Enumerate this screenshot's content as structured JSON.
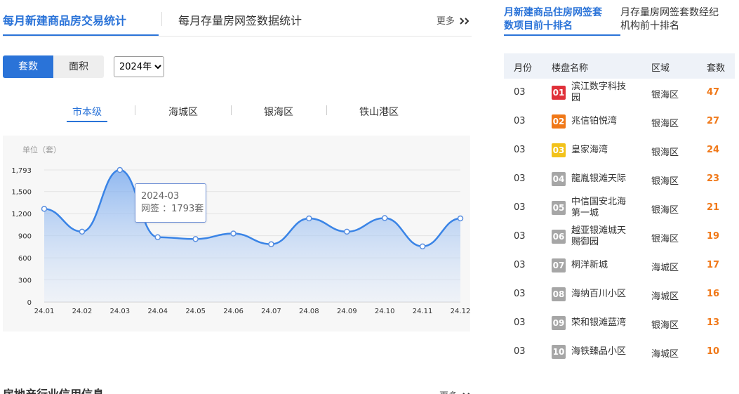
{
  "left_tabs": {
    "tab1": "每月新建商品房交易统计",
    "tab2": "每月存量房网签数据统计",
    "more": "更多",
    "more_icon": "double-chevron-right-icon"
  },
  "controls": {
    "btn_count": "套数",
    "btn_area": "面积",
    "year_selected": "2024年",
    "accent": "#2a73d8"
  },
  "district_tabs": [
    "市本级",
    "海城区",
    "银海区",
    "铁山港区"
  ],
  "chart_data": {
    "type": "area",
    "title": "",
    "ylabel": "单位（套）",
    "categories": [
      "24.01",
      "24.02",
      "24.03",
      "24.04",
      "24.05",
      "24.06",
      "24.07",
      "24.08",
      "24.09",
      "24.10",
      "24.11",
      "24.12"
    ],
    "series": [
      {
        "name": "网签",
        "values": [
          1265,
          955,
          1793,
          880,
          855,
          930,
          785,
          1135,
          955,
          1140,
          755,
          1135
        ]
      }
    ],
    "ylim": [
      0,
      1793
    ],
    "yticks": [
      0,
      300,
      600,
      900,
      1200,
      1500,
      1793
    ],
    "ytick_labels": [
      "0",
      "300",
      "600",
      "900",
      "1,200",
      "1,500",
      "1,793"
    ],
    "grid": true,
    "line_color": "#3a84e6",
    "tooltip": {
      "date": "2024-03",
      "label": "网签 ：1793套"
    }
  },
  "bottom": {
    "title": "房地产行业信用信息",
    "more": "更多"
  },
  "right_tabs": {
    "tab1_line1": "月新建商品住房网签套",
    "tab1_line2": "数项目前十排名",
    "tab2_line1": "月存量房网签套数经纪",
    "tab2_line2": "机构前十排名"
  },
  "ranking": {
    "headers": [
      "月份",
      "楼盘名称",
      "区域",
      "套数"
    ],
    "rows": [
      {
        "month": "03",
        "rank": "01",
        "name": "滨江数字科技园",
        "district": "银海区",
        "count": "47",
        "color": "#e0313a"
      },
      {
        "month": "03",
        "rank": "02",
        "name": "兆信铂悦湾",
        "district": "银海区",
        "count": "27",
        "color": "#f07818"
      },
      {
        "month": "03",
        "rank": "03",
        "name": "皇家海湾",
        "district": "银海区",
        "count": "24",
        "color": "#f2c21a"
      },
      {
        "month": "03",
        "rank": "04",
        "name": "龍胤银滩天际",
        "district": "银海区",
        "count": "23",
        "color": "#a6a6a6"
      },
      {
        "month": "03",
        "rank": "05",
        "name": "中信国安北海第一城",
        "district": "银海区",
        "count": "21",
        "color": "#a6a6a6"
      },
      {
        "month": "03",
        "rank": "06",
        "name": "越亚银滩城天赐御园",
        "district": "银海区",
        "count": "19",
        "color": "#a6a6a6"
      },
      {
        "month": "03",
        "rank": "07",
        "name": "桐洋新城",
        "district": "海城区",
        "count": "17",
        "color": "#a6a6a6"
      },
      {
        "month": "03",
        "rank": "08",
        "name": "海纳百川小区",
        "district": "海城区",
        "count": "16",
        "color": "#a6a6a6"
      },
      {
        "month": "03",
        "rank": "09",
        "name": "荣和银滩蓝湾",
        "district": "银海区",
        "count": "13",
        "color": "#a6a6a6"
      },
      {
        "month": "03",
        "rank": "10",
        "name": "海铁臻品小区",
        "district": "海城区",
        "count": "10",
        "color": "#a6a6a6"
      }
    ]
  }
}
